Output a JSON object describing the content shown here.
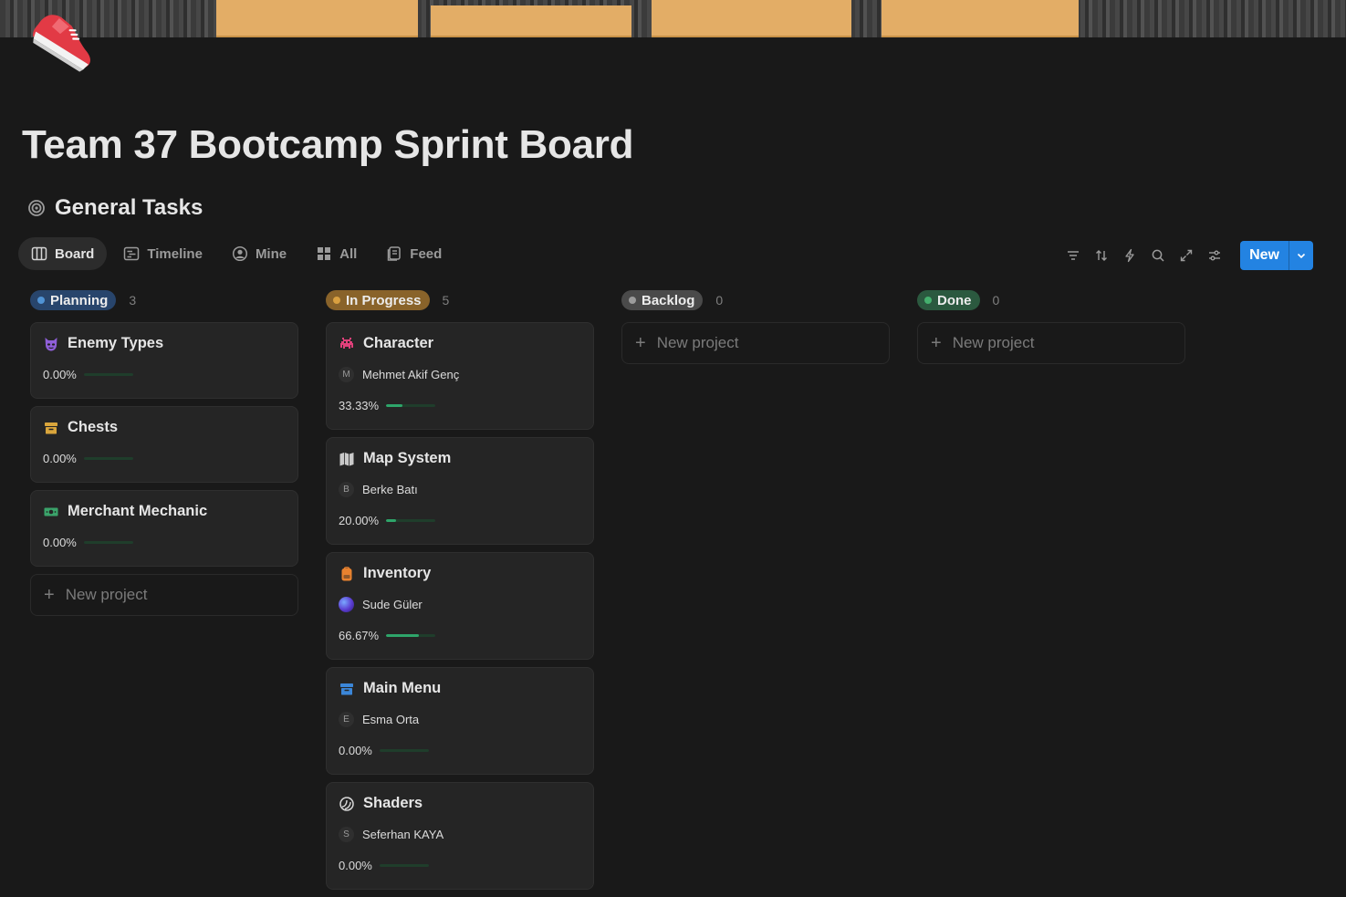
{
  "page": {
    "title": "Team 37 Bootcamp Sprint Board",
    "icon": "running-shoe-icon"
  },
  "database": {
    "icon": "target-icon",
    "title": "General Tasks"
  },
  "tabs": [
    {
      "label": "Board",
      "icon": "board-icon",
      "active": true
    },
    {
      "label": "Timeline",
      "icon": "timeline-icon",
      "active": false
    },
    {
      "label": "Mine",
      "icon": "person-icon",
      "active": false
    },
    {
      "label": "All",
      "icon": "grid-icon",
      "active": false
    },
    {
      "label": "Feed",
      "icon": "feed-icon",
      "active": false
    }
  ],
  "toolbar": {
    "tools": [
      "filter-icon",
      "sort-icon",
      "automation-icon",
      "search-icon",
      "expand-icon",
      "settings-icon"
    ],
    "new_label": "New"
  },
  "colors": {
    "accent": "#2383e2",
    "progress": "#2ea56a",
    "planning": "#28456c",
    "in_progress": "#89632a",
    "backlog": "#4a4a4a",
    "done": "#2b593f"
  },
  "columns": [
    {
      "label": "Planning",
      "count": "3",
      "dot": "#5093d4",
      "bg": "#28456c",
      "cards": [
        {
          "title": "Enemy Types",
          "icon": "devil-mask-icon",
          "progress": "0.00%",
          "pct": 0
        },
        {
          "title": "Chests",
          "icon": "archive-box-icon",
          "progress": "0.00%",
          "pct": 0
        },
        {
          "title": "Merchant Mechanic",
          "icon": "money-icon",
          "progress": "0.00%",
          "pct": 0
        }
      ],
      "new_label": "New project"
    },
    {
      "label": "In Progress",
      "count": "5",
      "dot": "#d9a040",
      "bg": "#89632a",
      "cards": [
        {
          "title": "Character",
          "icon": "space-invader-icon",
          "assignee": "Mehmet Akif Genç",
          "initial": "M",
          "progress": "33.33%",
          "pct": 33.33
        },
        {
          "title": "Map System",
          "icon": "map-icon",
          "assignee": "Berke Batı",
          "initial": "B",
          "progress": "20.00%",
          "pct": 20
        },
        {
          "title": "Inventory",
          "icon": "backpack-icon",
          "assignee": "Sude Güler",
          "initial": "",
          "progress": "66.67%",
          "pct": 66.67
        },
        {
          "title": "Main Menu",
          "icon": "archive-box-icon",
          "assignee": "Esma Orta",
          "initial": "E",
          "progress": "0.00%",
          "pct": 0
        },
        {
          "title": "Shaders",
          "icon": "shader-icon",
          "assignee": "Seferhan KAYA",
          "initial": "S",
          "progress": "0.00%",
          "pct": 0
        }
      ]
    },
    {
      "label": "Backlog",
      "count": "0",
      "dot": "#9b9b9b",
      "bg": "#4a4a4a",
      "cards": [],
      "new_label": "New project"
    },
    {
      "label": "Done",
      "count": "0",
      "dot": "#45b06e",
      "bg": "#2b593f",
      "cards": [],
      "new_label": "New project"
    }
  ]
}
